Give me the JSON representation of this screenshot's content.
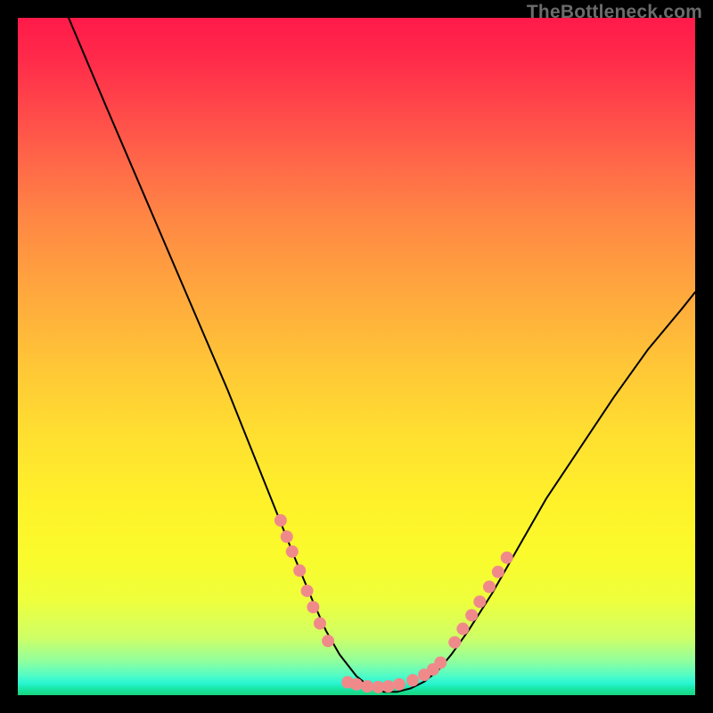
{
  "attribution": "TheBottleneck.com",
  "chart_data": {
    "type": "line",
    "title": "",
    "xlabel": "",
    "ylabel": "",
    "xlim": [
      0,
      100
    ],
    "ylim": [
      0,
      100
    ],
    "series": [
      {
        "name": "curve",
        "x": [
          7.5,
          13,
          19,
          25,
          31,
          35,
          38,
          41,
          43.5,
          45.5,
          47.5,
          50,
          52,
          54,
          56,
          58,
          60,
          62,
          64,
          66.5,
          70,
          74,
          78,
          83,
          88,
          93,
          98,
          100
        ],
        "y": [
          100,
          87,
          73,
          59,
          45,
          35,
          27.5,
          20,
          14,
          9.5,
          6,
          2.8,
          1.2,
          0.5,
          0.5,
          1.0,
          2.0,
          3.6,
          6.0,
          9.5,
          15,
          22,
          29,
          36.5,
          44,
          51,
          57,
          59.5
        ],
        "color": "#000000",
        "stroke_width": 2
      },
      {
        "name": "left-dots",
        "type": "scatter",
        "x": [
          38.8,
          39.7,
          40.5,
          41.6,
          42.7,
          43.6,
          44.6,
          45.8
        ],
        "y": [
          25.8,
          23.4,
          21.2,
          18.4,
          15.4,
          13.0,
          10.6,
          8.0
        ],
        "color": "#f08a8a",
        "radius": 7
      },
      {
        "name": "bottom-dots",
        "type": "scatter",
        "x": [
          48.7,
          50.0,
          51.6,
          53.2,
          54.7,
          56.3,
          58.3,
          60.0,
          61.3,
          62.4
        ],
        "y": [
          1.9,
          1.6,
          1.3,
          1.2,
          1.3,
          1.6,
          2.2,
          3.0,
          3.8,
          4.8
        ],
        "color": "#f08a8a",
        "radius": 7
      },
      {
        "name": "right-dots",
        "type": "scatter",
        "x": [
          64.5,
          65.7,
          67.0,
          68.2,
          69.6,
          70.9,
          72.2
        ],
        "y": [
          7.8,
          9.8,
          11.8,
          13.8,
          16.0,
          18.2,
          20.3
        ],
        "color": "#f08a8a",
        "radius": 7
      }
    ]
  }
}
